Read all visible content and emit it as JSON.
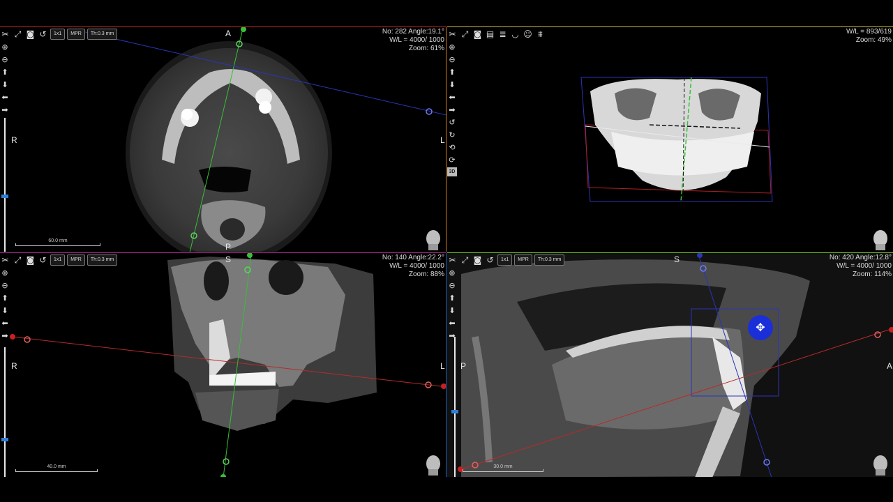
{
  "toolbar_icons": [
    "scissors-icon",
    "fullscreen-icon",
    "camera-icon",
    "reset-icon"
  ],
  "axial": {
    "layout_btn": "1x1",
    "mpr_btn": "MPR",
    "thickness_btn": "Th:0.3 mm",
    "info_line1": "No: 282 Angle:19.1°",
    "info_line2": "W/L = 4000/ 1000",
    "info_line3": "Zoom: 61%",
    "orient_top": "A",
    "orient_bottom": "P",
    "orient_left": "R",
    "orient_right": "L",
    "scale_label": "60.0 mm"
  },
  "volume3d": {
    "info_line1": "W/L = 893/619",
    "info_line2": "Zoom: 49%",
    "render_btn": "3D"
  },
  "coronal": {
    "layout_btn": "1x1",
    "mpr_btn": "MPR",
    "thickness_btn": "Th:0.3 mm",
    "info_line1": "No: 140 Angle:22.2°",
    "info_line2": "W/L = 4000/ 1000",
    "info_line3": "Zoom: 88%",
    "orient_top": "S",
    "orient_left": "R",
    "orient_right": "L",
    "scale_label": "40.0 mm"
  },
  "sagittal": {
    "layout_btn": "1x1",
    "mpr_btn": "MPR",
    "thickness_btn": "Th:0.3 mm",
    "info_line1": "No: 420 Angle:12.8°",
    "info_line2": "W/L = 4000/ 1000",
    "info_line3": "Zoom: 114%",
    "orient_top": "S",
    "orient_left": "P",
    "orient_right": "A",
    "scale_label": "30.0 mm"
  },
  "colors": {
    "axial_border": "#c2281e",
    "coronal_border": "#b12a92",
    "sagittal_border": "#7bc32f",
    "volume_border": "#cfc33a",
    "slider_knob": "#2f7fd8"
  }
}
